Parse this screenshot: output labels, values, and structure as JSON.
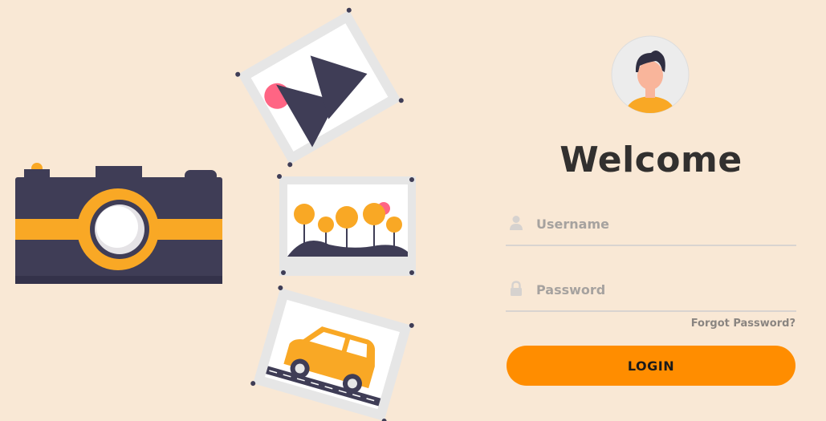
{
  "login": {
    "title": "Welcome",
    "username_placeholder": "Username",
    "password_placeholder": "Password",
    "forgot_label": "Forgot Password?",
    "login_label": "LOGIN"
  },
  "icons": {
    "avatar": "user-avatar-icon",
    "username": "user-icon",
    "password": "lock-icon"
  },
  "colors": {
    "background": "#f9e8d5",
    "accent": "#ff8d00",
    "camera_body": "#3f3d56",
    "camera_stripe": "#f9a825",
    "photo_pink": "#ff6584"
  }
}
